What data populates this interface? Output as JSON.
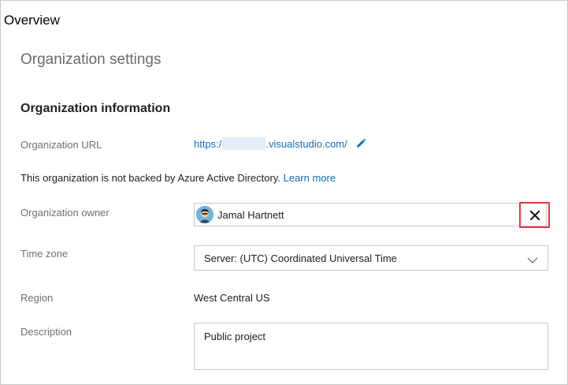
{
  "header": {
    "overview_title": "Overview"
  },
  "page": {
    "title": "Organization settings",
    "section_heading": "Organization information"
  },
  "url_field": {
    "label": "Organization URL",
    "prefix": "https:/",
    "suffix": ".visualstudio.com/",
    "edit_icon": "pencil-icon"
  },
  "notice": {
    "text": "This organization is not backed by Azure Active Directory.",
    "link": "Learn more"
  },
  "owner": {
    "label": "Organization owner",
    "name": "Jamal Hartnett",
    "clear_icon": "close-icon",
    "highlight_color": "#e0383e"
  },
  "timezone": {
    "label": "Time zone",
    "selected": "Server: (UTC) Coordinated Universal Time",
    "chevron_icon": "chevron-down-icon"
  },
  "region": {
    "label": "Region",
    "value": "West Central US"
  },
  "description": {
    "label": "Description",
    "value": "Public project"
  },
  "colors": {
    "link": "#106ebe",
    "label": "#707070",
    "border": "#c8c8c8"
  }
}
